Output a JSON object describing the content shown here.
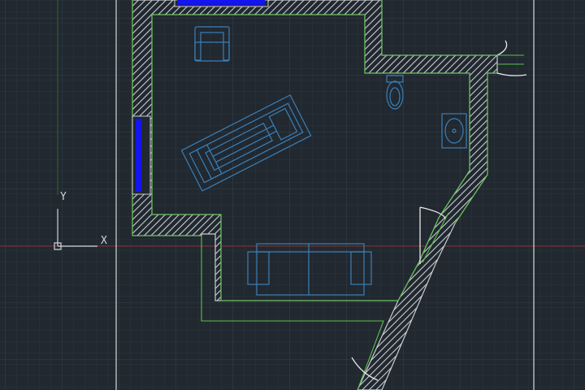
{
  "app": {
    "background_color": "#212830",
    "grid_minor_color": "#2b333c",
    "grid_major_color": "#37404a"
  },
  "ucs": {
    "x_label": "X",
    "y_label": "Y",
    "color": "#d0d4d8"
  },
  "layers": {
    "walls_color": "#c9ccd0",
    "wall_outline_color": "#5cc24a",
    "window_color": "#1414ee",
    "furniture_color": "#3a80b8",
    "door_color": "#e6e8ea",
    "x_axis_line_color": "#7a2b2b",
    "y_axis_line_color": "#2a6a2a",
    "border_line_color": "#d8dadc"
  },
  "icons": {
    "ucs": "ucs-icon",
    "armchair": "armchair-icon",
    "sofa": "sofa-icon",
    "treadmill": "treadmill-icon",
    "toilet": "toilet-icon",
    "sink": "sink-icon",
    "door": "door-icon"
  }
}
